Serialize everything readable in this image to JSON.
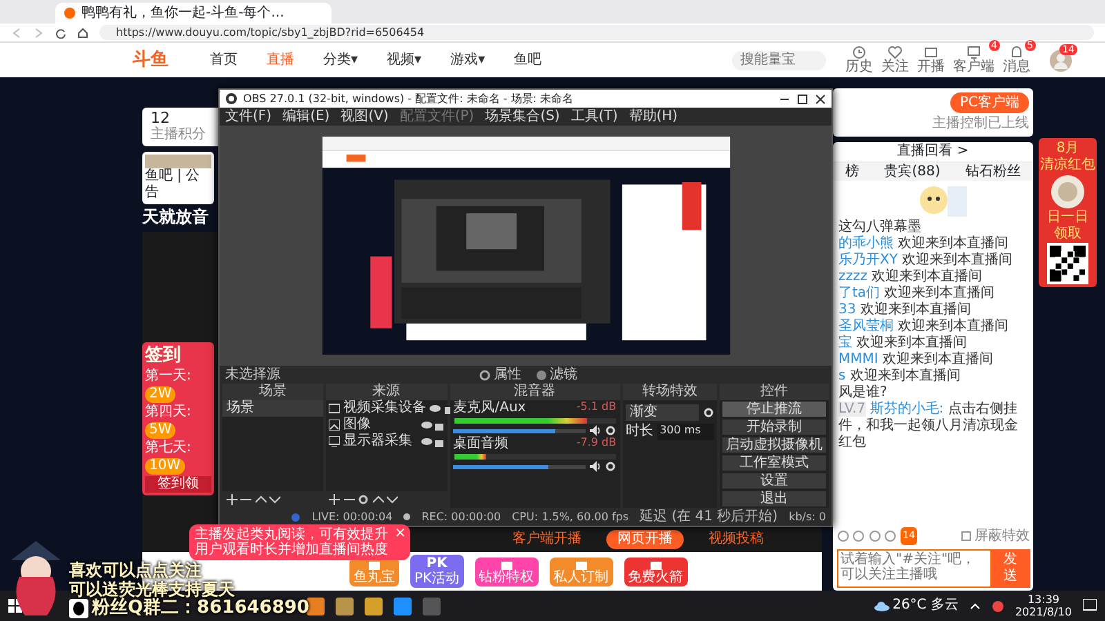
{
  "browser": {
    "tab_title": "鸭鸭有礼，鱼你一起-斗鱼-每个...",
    "url": "https://www.douyu.com/topic/sby1_zbjBD?rid=6506454"
  },
  "site_nav": {
    "logo": "斗鱼",
    "items": [
      {
        "label": "首页",
        "selected": false
      },
      {
        "label": "直播",
        "selected": true
      },
      {
        "label": "分类▾",
        "selected": false
      },
      {
        "label": "视频▾",
        "selected": false
      },
      {
        "label": "游戏▾",
        "selected": false
      },
      {
        "label": "鱼吧",
        "selected": false
      }
    ],
    "search_placeholder": "搜能量宝",
    "actions": [
      {
        "kind": "history",
        "label": "历史"
      },
      {
        "kind": "follow",
        "label": "关注"
      },
      {
        "kind": "live",
        "label": "开播"
      },
      {
        "kind": "client",
        "label": "客户端",
        "badge": "4"
      },
      {
        "kind": "message",
        "label": "消息",
        "badge": "5"
      }
    ],
    "avatar_badge": "14"
  },
  "stats": {
    "value": "12",
    "label": "主播积分"
  },
  "streamer": {
    "links": "鱼吧 | 公告",
    "title": "天就放音"
  },
  "signin_ad": {
    "title": "签到",
    "days": [
      {
        "label": "第一天:",
        "reward": "2W"
      },
      {
        "label": "第四天:",
        "reward": "5W"
      },
      {
        "label": "第七天:",
        "reward": "10W"
      }
    ],
    "button": "签到领"
  },
  "obs": {
    "title": "OBS 27.0.1 (32-bit, windows) - 配置文件: 未命名 - 场景: 未命名",
    "menu": [
      {
        "label": "文件(F)",
        "disabled": false
      },
      {
        "label": "编辑(E)",
        "disabled": false
      },
      {
        "label": "视图(V)",
        "disabled": false
      },
      {
        "label": "配置文件(P)",
        "disabled": true
      },
      {
        "label": "场景集合(S)",
        "disabled": false
      },
      {
        "label": "工具(T)",
        "disabled": false
      },
      {
        "label": "帮助(H)",
        "disabled": false
      }
    ],
    "source_bar": {
      "label": "未选择源",
      "properties": "属性",
      "filters": "滤镜"
    },
    "scenes": {
      "title": "场景",
      "items": [
        "场景"
      ]
    },
    "sources": {
      "title": "来源",
      "items": [
        {
          "kind": "camera",
          "label": "视频采集设备"
        },
        {
          "kind": "image",
          "label": "图像"
        },
        {
          "kind": "display",
          "label": "显示器采集"
        }
      ]
    },
    "mixer": {
      "title": "混音器",
      "channels": [
        {
          "name": "麦克风/Aux",
          "reading": "-5.1 dB",
          "meter": {
            "level": 0.82
          },
          "volume": {
            "level": 0.77
          }
        },
        {
          "name": "桌面音频",
          "reading": "-7.9 dB",
          "meter": {
            "level": 0.2
          },
          "volume": {
            "level": 0.72
          }
        }
      ]
    },
    "transitions": {
      "title": "转场特效",
      "selected": "渐变",
      "duration_label": "时长",
      "duration": "300 ms"
    },
    "controls": {
      "title": "控件",
      "buttons": [
        {
          "label": "停止推流",
          "selected": true
        },
        {
          "label": "开始录制",
          "selected": false
        },
        {
          "label": "启动虚拟摄像机",
          "selected": false
        },
        {
          "label": "工作室模式",
          "selected": false
        },
        {
          "label": "设置",
          "selected": false
        },
        {
          "label": "退出",
          "selected": false
        }
      ]
    },
    "status": {
      "live": "LIVE: 00:00:04",
      "rec": "REC: 00:00:00",
      "cpu": "CPU: 1.5%, 60.00 fps",
      "delay": "延迟 (在 41 秒后开始)",
      "bitrate": "kb/s: 0"
    }
  },
  "broadcast_modes": [
    {
      "label": "客户端开播",
      "selected": false
    },
    {
      "label": "网页开播",
      "selected": true
    },
    {
      "label": "视频投稿",
      "selected": false
    }
  ],
  "tip": {
    "text": "主播发起类丸阅读，可有效提升用户观看时长并增加直播间热度",
    "close": "×"
  },
  "gift_bar": [
    {
      "kind": "box",
      "label": "鱼丸宝"
    },
    {
      "kind": "pk",
      "icon_text": "PK",
      "label": "PK活动"
    },
    {
      "kind": "gift",
      "label": "钻粉特权"
    },
    {
      "kind": "box",
      "label": "私人订制"
    },
    {
      "kind": "rocket",
      "label": "免费火箭"
    }
  ],
  "client_card": {
    "button": "PC客户端",
    "note": "主播控制已上线"
  },
  "chat": {
    "replay": "直播回看 >",
    "tabs": [
      {
        "label": "榜"
      },
      {
        "label": "贵宾(88)"
      },
      {
        "label": "钻石粉丝"
      }
    ],
    "messages": [
      {
        "text": "这勾八弹幕墨"
      },
      {
        "user": "的乖小熊",
        "text": "欢迎来到本直播间"
      },
      {
        "user": "乐乃开XY",
        "text": "欢迎来到本直播间"
      },
      {
        "user": "zzzz",
        "text": "欢迎来到本直播间"
      },
      {
        "user": "了ta们",
        "text": "欢迎来到本直播间"
      },
      {
        "user": "33",
        "text": "欢迎来到本直播间"
      },
      {
        "user": "圣风莹桐",
        "text": "欢迎来到本直播间"
      },
      {
        "user": "宝",
        "text": "欢迎来到本直播间"
      },
      {
        "user": "MMMI",
        "text": "欢迎来到本直播间"
      },
      {
        "user": "s",
        "text": "欢迎来到本直播间"
      },
      {
        "text": "风是谁?"
      },
      {
        "level": "LV.7",
        "user": "斯芬的小毛:",
        "text": "点击右侧挂件，和我一起领八月清凉现金红包"
      }
    ],
    "toolbar_badge": "14",
    "effects_toggle": {
      "label": "屏蔽特效",
      "checked": false
    },
    "input_placeholder": "试着输入\"#关注\"吧，可以关注主播哦",
    "send": "发送"
  },
  "side_ad": {
    "title": "8月",
    "subtitle": "清凉红包",
    "line": "日一日",
    "action": "领取"
  },
  "overlay": {
    "lines": [
      "喜欢可以点点关注",
      "可以送荧光棒支持夏天"
    ],
    "group": "粉丝Q群二：861646890"
  },
  "taskbar": {
    "weather": "26°C 多云",
    "time": "13:39",
    "date": "2021/8/10"
  }
}
